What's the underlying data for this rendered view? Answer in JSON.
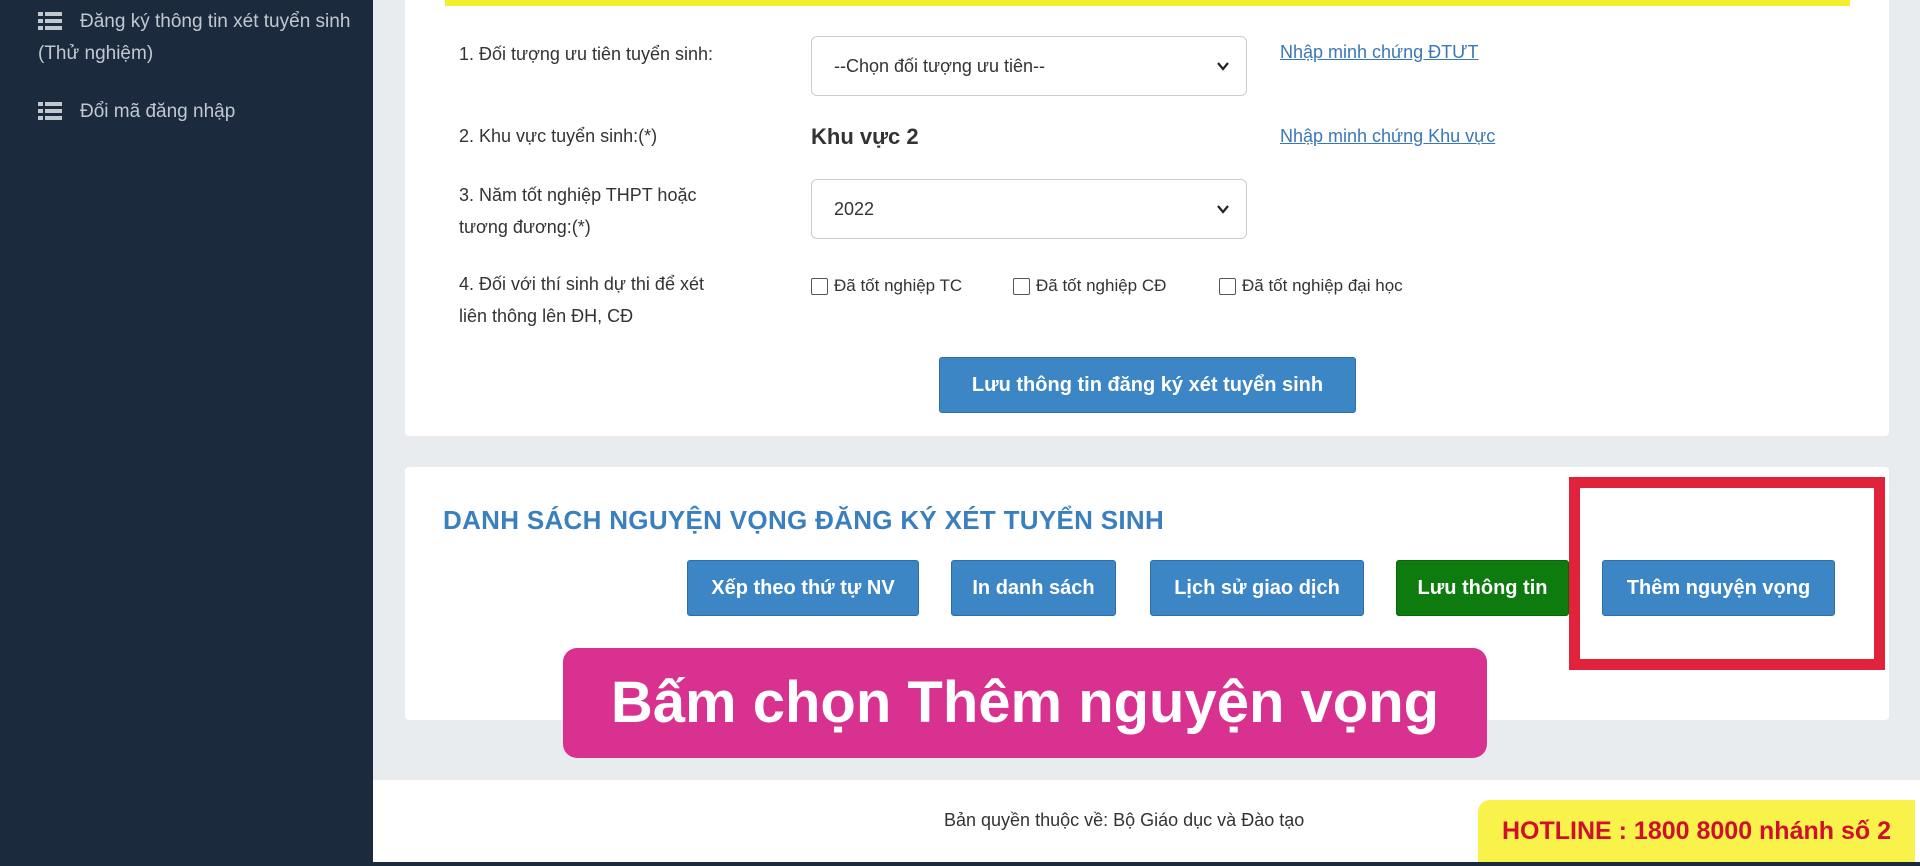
{
  "sidebar": {
    "items": [
      {
        "label": "Đăng ký thông tin xét tuyển sinh (Thử nghiệm)",
        "icon": "list-icon"
      },
      {
        "label": "Đổi mã đăng nhập",
        "icon": "list-icon"
      }
    ]
  },
  "form": {
    "priority_label": "1. Đối tượng ưu tiên tuyển sinh:",
    "priority_select": "--Chọn đối tượng ưu tiên--",
    "priority_link": "Nhập minh chứng ĐTƯT",
    "area_label": "2. Khu vực tuyển sinh:(*)",
    "area_value": "Khu vực 2",
    "area_link": "Nhập minh chứng Khu vực",
    "year_label_line1": "3. Năm tốt nghiệp THPT hoặc",
    "year_label_line2": "tương đương:(*)",
    "year_select": "2022",
    "transfer_label_line1": "4. Đối với thí sinh dự thi để xét",
    "transfer_label_line2": "liên thông lên ĐH, CĐ",
    "check_tc": "Đã tốt nghiệp TC",
    "check_cd": "Đã tốt nghiệp CĐ",
    "check_dh": "Đã tốt nghiệp đại học",
    "save_registration": "Lưu thông tin đăng ký xét tuyển sinh"
  },
  "list": {
    "title": "DANH SÁCH NGUYỆN VỌNG ĐĂNG KÝ XÉT TUYỂN SINH",
    "btn_sort": "Xếp theo thứ tự NV",
    "btn_print": "In danh sách",
    "btn_history": "Lịch sử giao dịch",
    "btn_save": "Lưu thông tin",
    "btn_add": "Thêm nguyện vọng"
  },
  "annotation": {
    "banner": "Bấm chọn Thêm nguyện vọng",
    "highlight_color": "#e0233a",
    "banner_color": "#d9318f"
  },
  "footer": {
    "copyright": "Bản quyền thuộc về: Bộ Giáo dục và Đào tạo",
    "hotline": "HOTLINE : 1800 8000 nhánh số 2"
  }
}
